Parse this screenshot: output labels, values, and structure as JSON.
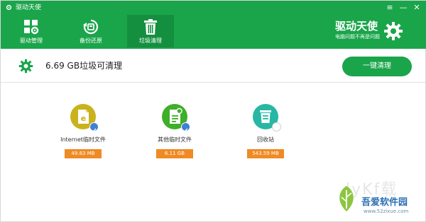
{
  "app": {
    "title": "驱动天使",
    "window_controls": {
      "menu": "≡",
      "minimize": "—",
      "close": "✕"
    }
  },
  "nav": {
    "items": [
      {
        "label": "驱动管理",
        "icon": "apps-gear-icon",
        "active": false
      },
      {
        "label": "备份还原",
        "icon": "restore-icon",
        "active": false
      },
      {
        "label": "垃圾清理",
        "icon": "trash-icon",
        "active": true
      }
    ]
  },
  "brand": {
    "name": "驱动天使",
    "slogan": "电脑问题不再是问题",
    "icon": "gear-icon"
  },
  "summary": {
    "text": "6.69 GB垃圾可清理",
    "icon": "gear-icon",
    "clean_button_label": "一键清理"
  },
  "items": [
    {
      "label": "Internet临时文件",
      "size": "49.83 MB",
      "icon": "internet-explorer-icon",
      "color": "#c9b21c",
      "checked": true
    },
    {
      "label": "其他临时文件",
      "size": "6.11 GB",
      "icon": "temp-files-icon",
      "color": "#3fae2a",
      "checked": true
    },
    {
      "label": "回收站",
      "size": "543.59 MB",
      "icon": "recycle-bin-icon",
      "color": "#28b7a4",
      "checked": false
    }
  ],
  "watermark": {
    "faint_text": "lyKf载",
    "main": "吾爱软件园",
    "url": "www.52zixue.com"
  },
  "colors": {
    "header_green": "#1aa54a",
    "active_tab": "#148f3f",
    "size_badge_orange": "#f08a24",
    "check_badge_blue": "#3f7fd6"
  }
}
